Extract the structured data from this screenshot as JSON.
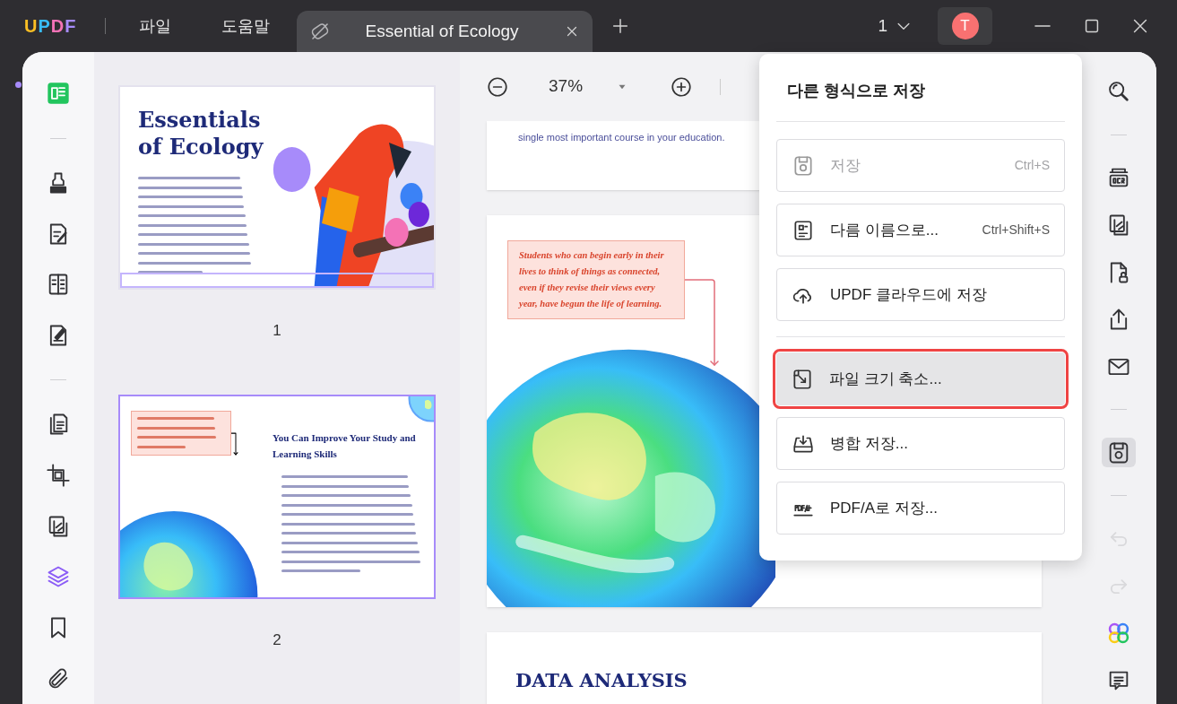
{
  "app_bar": {
    "logo": "UPDF",
    "menus": [
      "파일",
      "도움말"
    ],
    "tabs": [
      {
        "title": "Essential of Ecology",
        "selected": true
      }
    ],
    "page_indicator": "1",
    "avatar": "T"
  },
  "left_toolbar": [
    {
      "kind": "reader",
      "selected": true
    },
    {
      "kind": "divider"
    },
    {
      "kind": "comment",
      "selected": false
    },
    {
      "kind": "edit",
      "selected": false
    },
    {
      "kind": "form",
      "selected": false
    },
    {
      "kind": "sign",
      "selected": false
    },
    {
      "kind": "divider"
    },
    {
      "kind": "organize",
      "selected": false
    },
    {
      "kind": "crop",
      "selected": false
    },
    {
      "kind": "convert",
      "selected": false
    },
    {
      "kind": "layers",
      "selected": false
    },
    {
      "kind": "bookmark",
      "selected": false
    },
    {
      "kind": "attachment",
      "selected": false
    }
  ],
  "thumbnails": [
    {
      "kind": "cover",
      "title": "Essentials of Ecology",
      "number": "1",
      "selected": false,
      "viewport": true
    },
    {
      "kind": "spread",
      "heading": "You Can Improve Your Study and Learning Skills",
      "number": "2",
      "selected": true,
      "viewport": false
    }
  ],
  "zoom": {
    "value": "37%"
  },
  "pages": [
    {
      "kind": "text_end",
      "text": "single most important course in your education."
    },
    {
      "kind": "callout_globe",
      "callout": "Students who can begin early in their lives to think of things as connected, even if they revise their views every year, have begun the life of learning."
    },
    {
      "kind": "heading",
      "heading": "DATA ANALYSIS"
    }
  ],
  "save_menu": {
    "title": "다른 형식으로 저장",
    "items": [
      {
        "kind": "save",
        "label": "저장",
        "shortcut": "Ctrl+S",
        "disabled": true,
        "selected": false
      },
      {
        "kind": "save_as",
        "label": "다름 이름으로...",
        "shortcut": "Ctrl+Shift+S",
        "disabled": false,
        "selected": false
      },
      {
        "kind": "cloud",
        "label": "UPDF 클라우드에 저장",
        "disabled": false,
        "selected": false
      },
      {
        "kind": "separator"
      },
      {
        "kind": "compress",
        "label": "파일 크기 축소...",
        "disabled": false,
        "selected": true
      },
      {
        "kind": "merge",
        "label": "병합 저장...",
        "disabled": false,
        "selected": false
      },
      {
        "kind": "pdfa",
        "label": "PDF/A로 저장...",
        "disabled": false,
        "selected": false
      }
    ]
  },
  "right_toolbar": [
    {
      "kind": "search",
      "selected": false,
      "disabled": false
    },
    {
      "kind": "divider"
    },
    {
      "kind": "ocr",
      "selected": false,
      "disabled": false
    },
    {
      "kind": "convert",
      "selected": false,
      "disabled": false
    },
    {
      "kind": "protect",
      "selected": false,
      "disabled": false
    },
    {
      "kind": "share",
      "selected": false,
      "disabled": false
    },
    {
      "kind": "mail",
      "selected": false,
      "disabled": false
    },
    {
      "kind": "divider"
    },
    {
      "kind": "save",
      "selected": true,
      "disabled": false
    },
    {
      "kind": "divider"
    },
    {
      "kind": "undo",
      "selected": false,
      "disabled": true
    },
    {
      "kind": "redo",
      "selected": false,
      "disabled": true
    },
    {
      "kind": "ai",
      "selected": false,
      "disabled": false
    },
    {
      "kind": "comment",
      "selected": false,
      "disabled": false
    }
  ]
}
